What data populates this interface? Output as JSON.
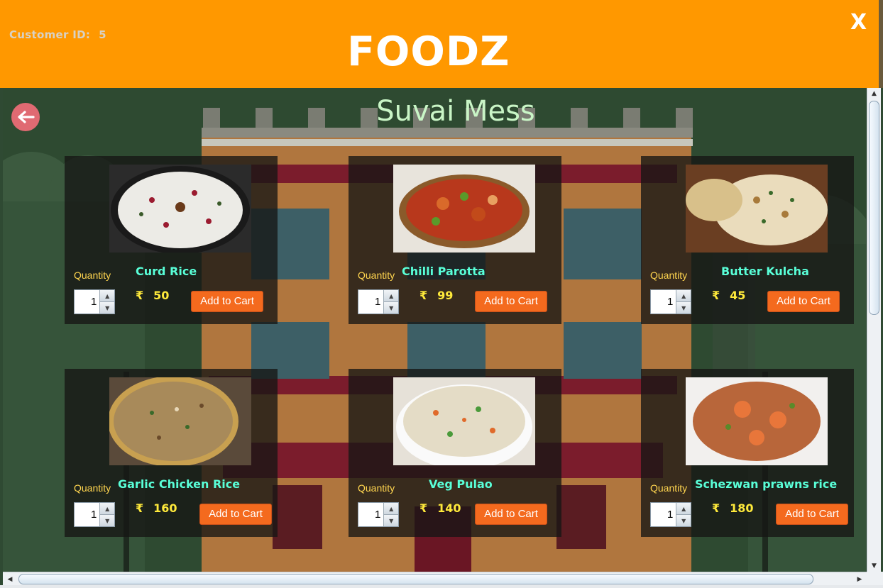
{
  "header": {
    "customer_label": "Customer ID:",
    "customer_id": "5",
    "brand": "FOODZ",
    "close_label": "X"
  },
  "restaurant": {
    "name": "Suvai Mess"
  },
  "labels": {
    "quantity": "Quantity",
    "add_to_cart": "Add to Cart",
    "currency": "₹"
  },
  "items": [
    {
      "name": "Curd Rice",
      "price": "50",
      "qty": "1"
    },
    {
      "name": "Chilli Parotta",
      "price": "99",
      "qty": "1"
    },
    {
      "name": "Butter Kulcha",
      "price": "45",
      "qty": "1"
    },
    {
      "name": "Garlic Chicken Rice",
      "price": "160",
      "qty": "1"
    },
    {
      "name": "Veg Pulao",
      "price": "140",
      "qty": "1"
    },
    {
      "name": "Schezwan prawns rice",
      "price": "180",
      "qty": "1"
    }
  ],
  "icons": {
    "back": "arrow-left-icon",
    "close": "close-icon",
    "spinner_up": "triangle-up-icon",
    "spinner_down": "triangle-down-icon"
  },
  "colors": {
    "header": "#ff9800",
    "title": "#c9f5c6",
    "item_name": "#59ffd8",
    "price": "#ffea3b",
    "quantity_label": "#ffd54f",
    "cart_button": "#f46a1e",
    "back_button": "#e06a72"
  }
}
